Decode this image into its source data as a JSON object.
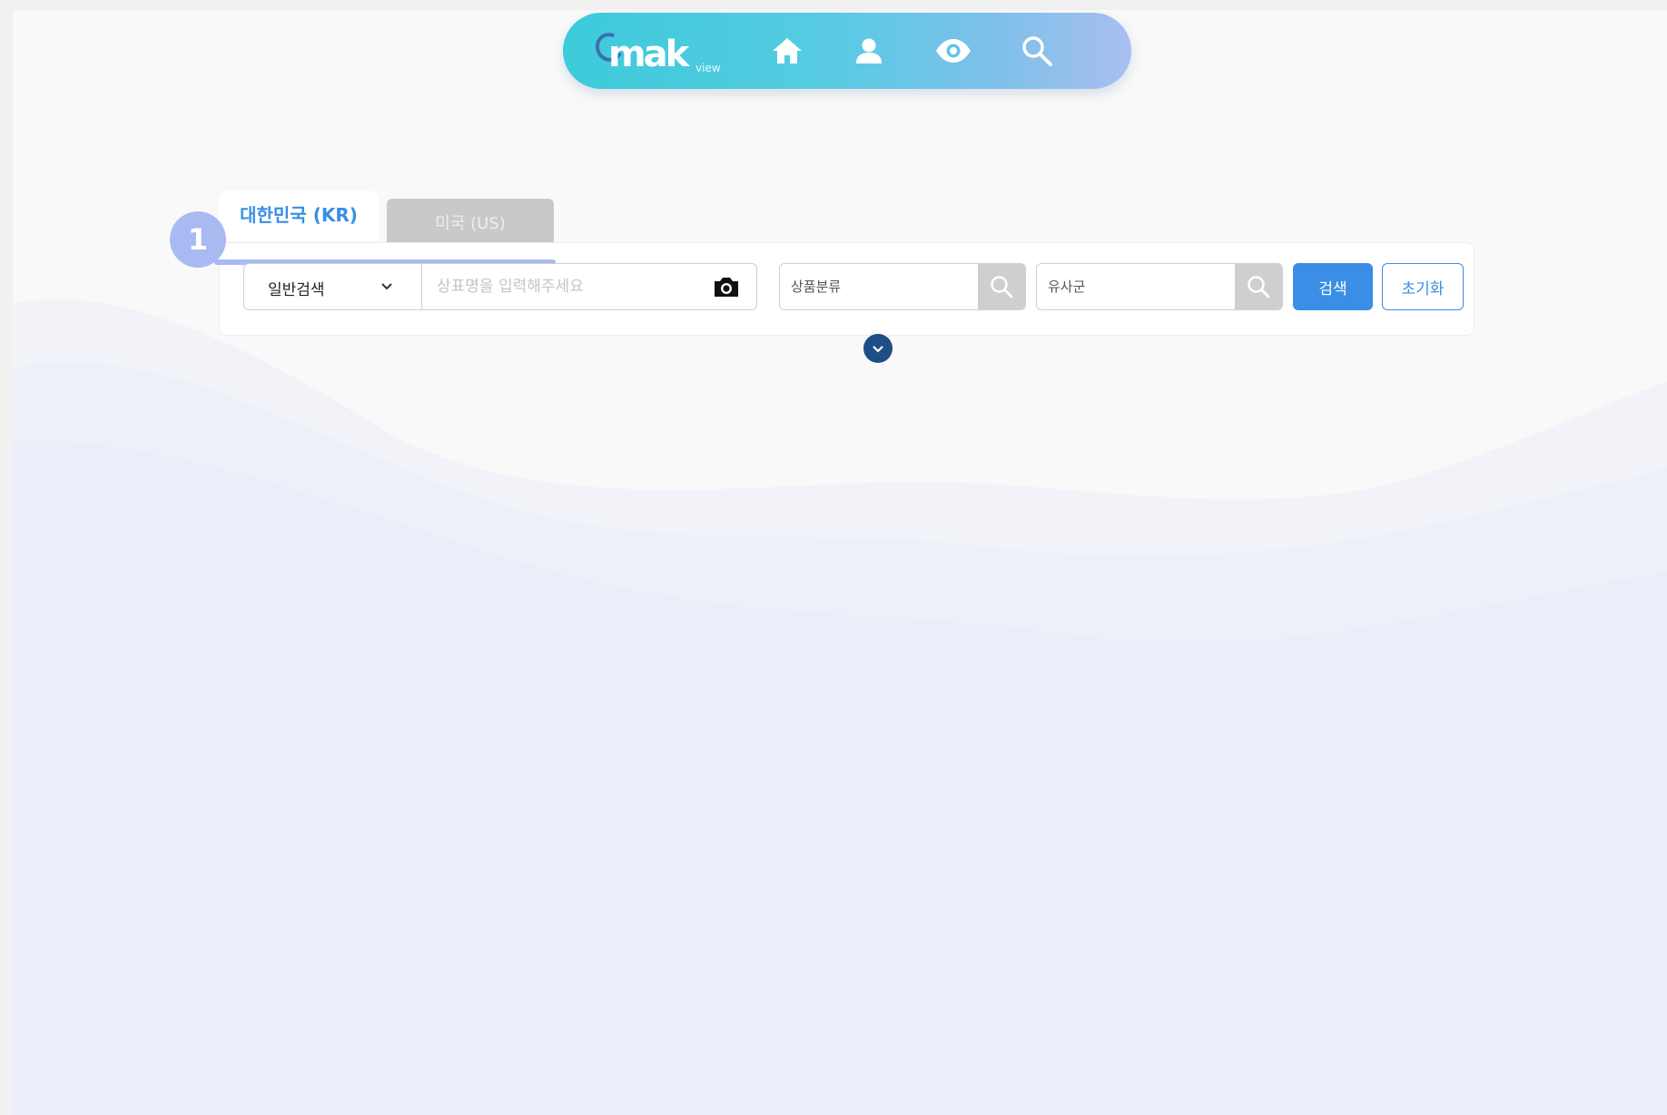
{
  "nav": {
    "logo_text": "mak",
    "logo_sub": "view",
    "icons": [
      "home-icon",
      "user-icon",
      "eye-icon",
      "search-icon"
    ]
  },
  "tabs": [
    {
      "label": "대한민국 (KR)",
      "active": true
    },
    {
      "label": "미국 (US)",
      "active": false
    }
  ],
  "step_badge": "1",
  "search": {
    "type_selected": "일반검색",
    "name_placeholder": "상표명을 입력해주세요",
    "class_placeholder": "상품분류",
    "group_placeholder": "유사군",
    "search_label": "검색",
    "reset_label": "초기화"
  },
  "colors": {
    "accent": "#3a8ee6",
    "badge": "#a9baf3",
    "nav_gradient_start": "#3ccbda",
    "nav_gradient_end": "#a8bff0",
    "expand_button": "#1f4e86"
  }
}
